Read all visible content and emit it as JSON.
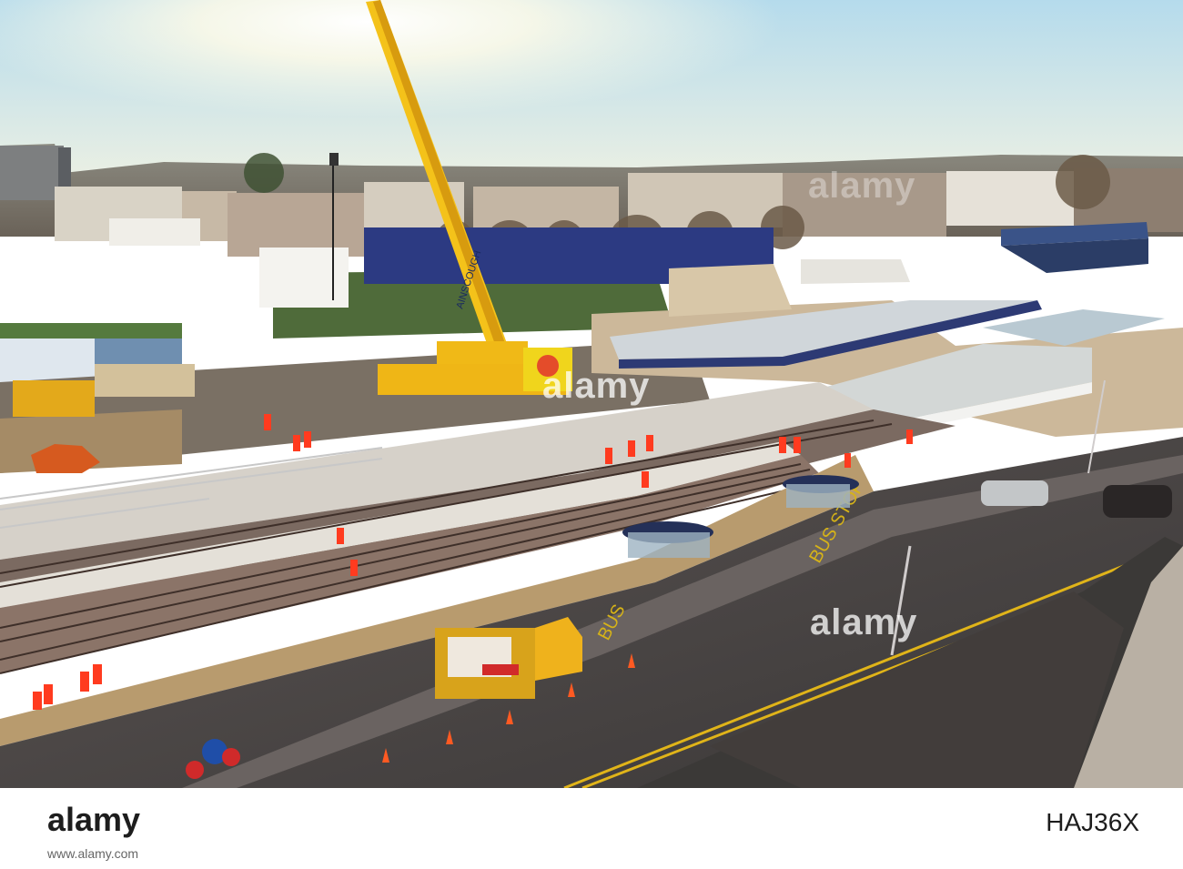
{
  "photo": {
    "watermark_center": "alamy",
    "watermark_right": "alamy",
    "watermark_top": "alamy",
    "bus_marking_1": "BUS",
    "bus_marking_2": "BUS STOP",
    "crane_label": "AINSCOUGH"
  },
  "footer": {
    "logo": "alamy",
    "image_id": "HAJ36X",
    "strip_url": "www.alamy.com"
  },
  "colors": {
    "sky_top": "#a9d3e6",
    "sky_glow": "#fbf7e6",
    "crane_yellow": "#f4c21a",
    "worker_orange": "#ff3b1f",
    "road": "#4a4747",
    "track_bed": "#8a7468",
    "platform": "#cfcac2"
  }
}
